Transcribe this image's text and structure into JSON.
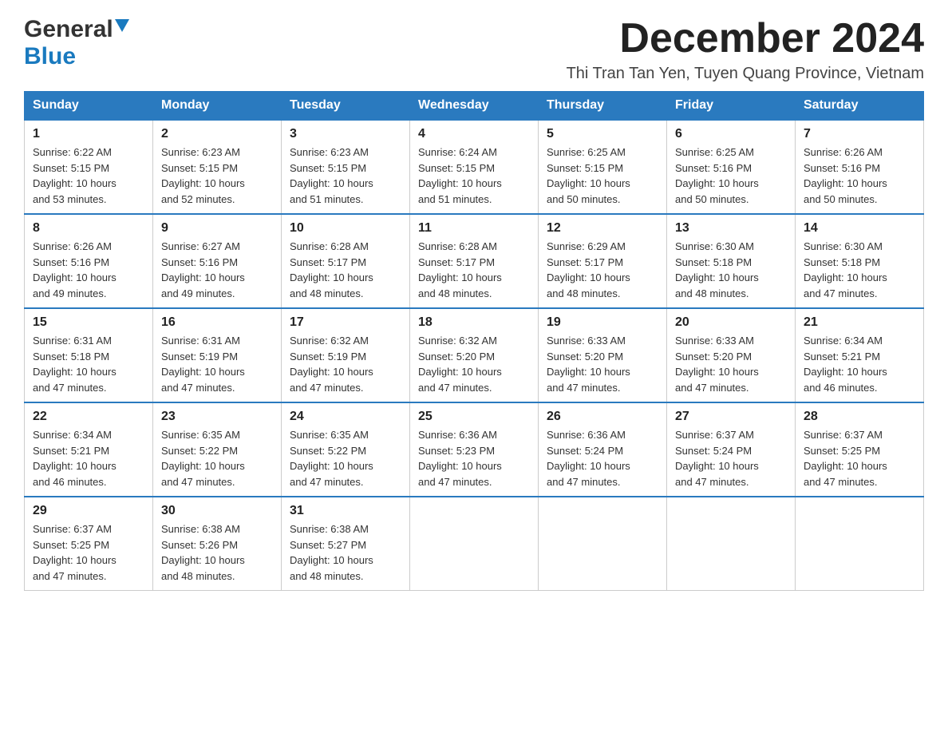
{
  "logo": {
    "general": "General",
    "blue": "Blue"
  },
  "title": {
    "month_year": "December 2024",
    "location": "Thi Tran Tan Yen, Tuyen Quang Province, Vietnam"
  },
  "days_of_week": [
    "Sunday",
    "Monday",
    "Tuesday",
    "Wednesday",
    "Thursday",
    "Friday",
    "Saturday"
  ],
  "weeks": [
    [
      {
        "day": "1",
        "sunrise": "6:22 AM",
        "sunset": "5:15 PM",
        "daylight": "10 hours and 53 minutes."
      },
      {
        "day": "2",
        "sunrise": "6:23 AM",
        "sunset": "5:15 PM",
        "daylight": "10 hours and 52 minutes."
      },
      {
        "day": "3",
        "sunrise": "6:23 AM",
        "sunset": "5:15 PM",
        "daylight": "10 hours and 51 minutes."
      },
      {
        "day": "4",
        "sunrise": "6:24 AM",
        "sunset": "5:15 PM",
        "daylight": "10 hours and 51 minutes."
      },
      {
        "day": "5",
        "sunrise": "6:25 AM",
        "sunset": "5:15 PM",
        "daylight": "10 hours and 50 minutes."
      },
      {
        "day": "6",
        "sunrise": "6:25 AM",
        "sunset": "5:16 PM",
        "daylight": "10 hours and 50 minutes."
      },
      {
        "day": "7",
        "sunrise": "6:26 AM",
        "sunset": "5:16 PM",
        "daylight": "10 hours and 50 minutes."
      }
    ],
    [
      {
        "day": "8",
        "sunrise": "6:26 AM",
        "sunset": "5:16 PM",
        "daylight": "10 hours and 49 minutes."
      },
      {
        "day": "9",
        "sunrise": "6:27 AM",
        "sunset": "5:16 PM",
        "daylight": "10 hours and 49 minutes."
      },
      {
        "day": "10",
        "sunrise": "6:28 AM",
        "sunset": "5:17 PM",
        "daylight": "10 hours and 48 minutes."
      },
      {
        "day": "11",
        "sunrise": "6:28 AM",
        "sunset": "5:17 PM",
        "daylight": "10 hours and 48 minutes."
      },
      {
        "day": "12",
        "sunrise": "6:29 AM",
        "sunset": "5:17 PM",
        "daylight": "10 hours and 48 minutes."
      },
      {
        "day": "13",
        "sunrise": "6:30 AM",
        "sunset": "5:18 PM",
        "daylight": "10 hours and 48 minutes."
      },
      {
        "day": "14",
        "sunrise": "6:30 AM",
        "sunset": "5:18 PM",
        "daylight": "10 hours and 47 minutes."
      }
    ],
    [
      {
        "day": "15",
        "sunrise": "6:31 AM",
        "sunset": "5:18 PM",
        "daylight": "10 hours and 47 minutes."
      },
      {
        "day": "16",
        "sunrise": "6:31 AM",
        "sunset": "5:19 PM",
        "daylight": "10 hours and 47 minutes."
      },
      {
        "day": "17",
        "sunrise": "6:32 AM",
        "sunset": "5:19 PM",
        "daylight": "10 hours and 47 minutes."
      },
      {
        "day": "18",
        "sunrise": "6:32 AM",
        "sunset": "5:20 PM",
        "daylight": "10 hours and 47 minutes."
      },
      {
        "day": "19",
        "sunrise": "6:33 AM",
        "sunset": "5:20 PM",
        "daylight": "10 hours and 47 minutes."
      },
      {
        "day": "20",
        "sunrise": "6:33 AM",
        "sunset": "5:20 PM",
        "daylight": "10 hours and 47 minutes."
      },
      {
        "day": "21",
        "sunrise": "6:34 AM",
        "sunset": "5:21 PM",
        "daylight": "10 hours and 46 minutes."
      }
    ],
    [
      {
        "day": "22",
        "sunrise": "6:34 AM",
        "sunset": "5:21 PM",
        "daylight": "10 hours and 46 minutes."
      },
      {
        "day": "23",
        "sunrise": "6:35 AM",
        "sunset": "5:22 PM",
        "daylight": "10 hours and 47 minutes."
      },
      {
        "day": "24",
        "sunrise": "6:35 AM",
        "sunset": "5:22 PM",
        "daylight": "10 hours and 47 minutes."
      },
      {
        "day": "25",
        "sunrise": "6:36 AM",
        "sunset": "5:23 PM",
        "daylight": "10 hours and 47 minutes."
      },
      {
        "day": "26",
        "sunrise": "6:36 AM",
        "sunset": "5:24 PM",
        "daylight": "10 hours and 47 minutes."
      },
      {
        "day": "27",
        "sunrise": "6:37 AM",
        "sunset": "5:24 PM",
        "daylight": "10 hours and 47 minutes."
      },
      {
        "day": "28",
        "sunrise": "6:37 AM",
        "sunset": "5:25 PM",
        "daylight": "10 hours and 47 minutes."
      }
    ],
    [
      {
        "day": "29",
        "sunrise": "6:37 AM",
        "sunset": "5:25 PM",
        "daylight": "10 hours and 47 minutes."
      },
      {
        "day": "30",
        "sunrise": "6:38 AM",
        "sunset": "5:26 PM",
        "daylight": "10 hours and 48 minutes."
      },
      {
        "day": "31",
        "sunrise": "6:38 AM",
        "sunset": "5:27 PM",
        "daylight": "10 hours and 48 minutes."
      },
      null,
      null,
      null,
      null
    ]
  ],
  "labels": {
    "sunrise_prefix": "Sunrise: ",
    "sunset_prefix": "Sunset: ",
    "daylight_prefix": "Daylight: "
  }
}
